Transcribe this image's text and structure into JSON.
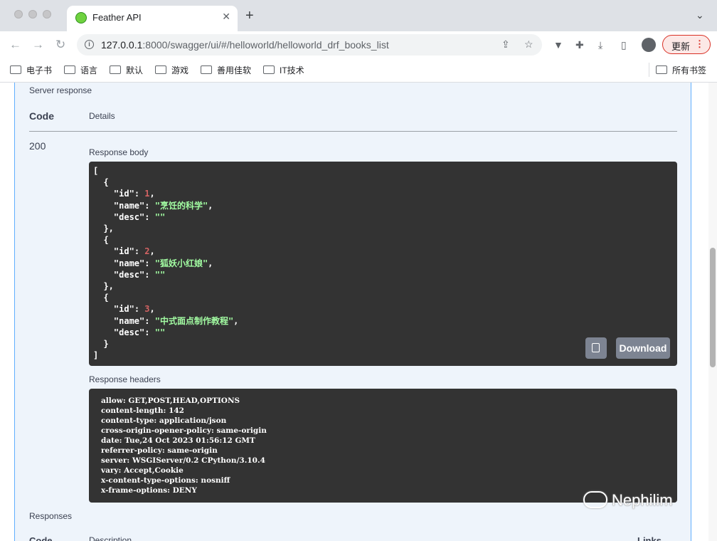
{
  "browser": {
    "tab_title": "Feather API",
    "url_host": "127.0.0.1",
    "url_rest": ":8000/swagger/ui/#/helloworld/helloworld_drf_books_list",
    "update_label": "更新",
    "bookmarks": [
      "电子书",
      "语言",
      "默认",
      "游戏",
      "善用佳软",
      "IT技术"
    ],
    "all_bookmarks": "所有书签",
    "accent_update": "#d93025"
  },
  "response": {
    "section_title": "Server response",
    "col_code": "Code",
    "col_details": "Details",
    "status_code": "200",
    "body_label": "Response body",
    "download_label": "Download",
    "headers_label": "Response headers",
    "headers_text": "allow: GET,POST,HEAD,OPTIONS\ncontent-length: 142\ncontent-type: application/json\ncross-origin-opener-policy: same-origin\ndate: Tue,24 Oct 2023 01:56:12 GMT\nreferrer-policy: same-origin\nserver: WSGIServer/0.2 CPython/3.10.4\nvary: Accept,Cookie\nx-content-type-options: nosniff\nx-frame-options: DENY",
    "books": [
      {
        "id": "1",
        "name": "\"烹饪的科学\"",
        "desc": "\"\""
      },
      {
        "id": "2",
        "name": "\"狐妖小红娘\"",
        "desc": "\"\""
      },
      {
        "id": "3",
        "name": "\"中式面点制作教程\"",
        "desc": "\"\""
      }
    ]
  },
  "responses": {
    "title": "Responses",
    "col_code": "Code",
    "col_description": "Description",
    "col_links": "Links"
  },
  "watermark": "Nephilim",
  "colors": {
    "panel_border": "#61affe",
    "panel_bg": "#eef4fb",
    "code_bg": "#333333",
    "json_number": "#d36363",
    "json_string": "#a2fca2"
  }
}
